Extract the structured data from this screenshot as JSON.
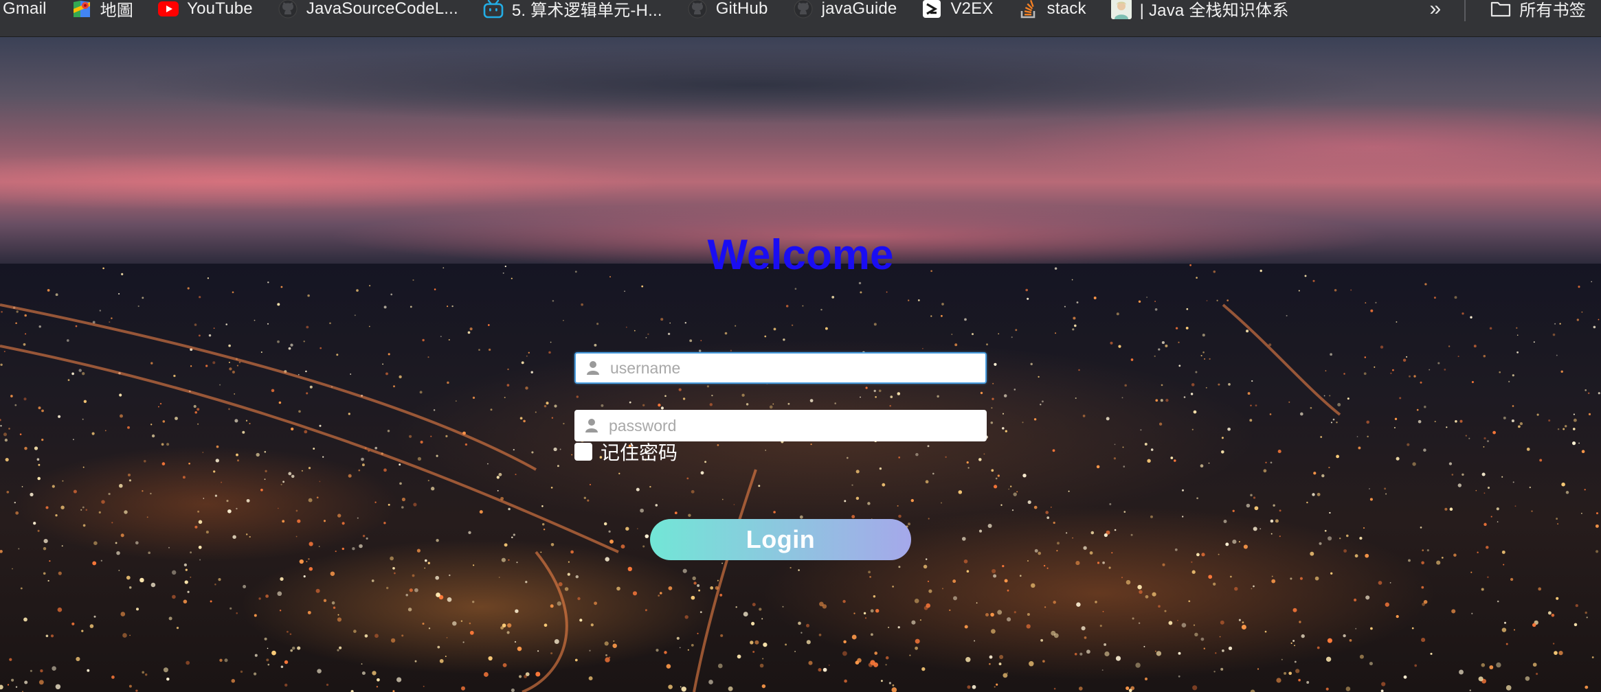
{
  "bookmarks": [
    {
      "label": "Gmail",
      "icon": "gmail-icon"
    },
    {
      "label": "地圖",
      "icon": "maps-icon"
    },
    {
      "label": "YouTube",
      "icon": "youtube-icon"
    },
    {
      "label": "JavaSourceCodeL...",
      "icon": "github-icon"
    },
    {
      "label": "5. 算术逻辑单元-H...",
      "icon": "bilibili-icon"
    },
    {
      "label": "GitHub",
      "icon": "github-icon"
    },
    {
      "label": "javaGuide",
      "icon": "github-icon"
    },
    {
      "label": "V2EX",
      "icon": "v2ex-icon"
    },
    {
      "label": "stack",
      "icon": "stackoverflow-icon"
    },
    {
      "label": "| Java 全栈知识体系",
      "icon": "avatar-icon"
    }
  ],
  "bookmarks_more": "»",
  "all_bookmarks": "所有书签",
  "login": {
    "title": "Welcome",
    "username_placeholder": "username",
    "password_placeholder": "password",
    "remember_label": "记住密码",
    "button_label": "Login"
  },
  "colors": {
    "title": "#1a0df2",
    "button_gradient_start": "#72e6d6",
    "button_gradient_end": "#a5a8ea",
    "bookmarks_bar_bg": "#333437"
  }
}
